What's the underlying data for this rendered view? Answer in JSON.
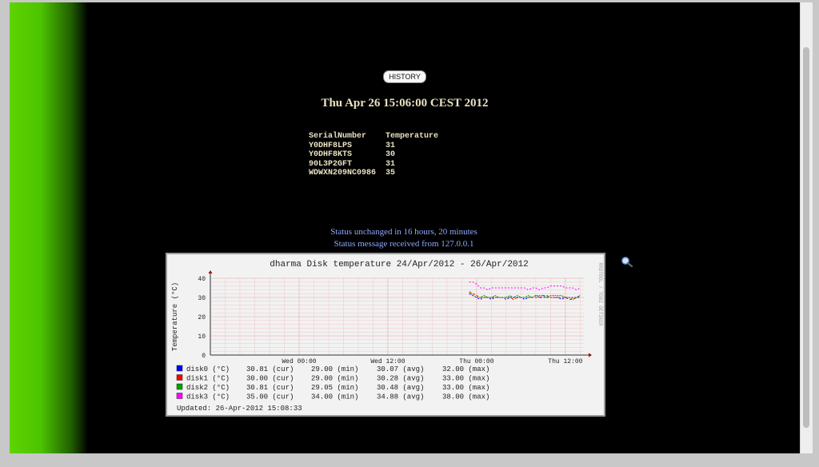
{
  "history_label": "HISTORY",
  "date": "Thu Apr 26 15:06:00 CEST 2012",
  "table": {
    "headers": [
      "SerialNumber",
      "Temperature"
    ],
    "rows": [
      [
        "Y0DHF8LPS",
        "31"
      ],
      [
        "Y0DHF8KTS",
        "30"
      ],
      [
        "90L3P2GFT",
        "31"
      ],
      [
        "WDWXN209NC0986",
        "35"
      ]
    ]
  },
  "status_line1": "Status unchanged in 16 hours, 20 minutes",
  "status_line2": "Status message received from 127.0.0.1",
  "zoom_icon": "magnifier-icon",
  "chart_data": {
    "type": "line",
    "title": "dharma Disk temperature 24/Apr/2012 - 26/Apr/2012",
    "ylabel": "Temperature (°C)",
    "watermark": "RRDTOOL / TOBI OETIKER",
    "ylim": [
      0,
      40
    ],
    "yticks": [
      0,
      10,
      20,
      30,
      40
    ],
    "xticks": [
      "Wed 00:00",
      "Wed 12:00",
      "Thu 00:00",
      "Thu 12:00"
    ],
    "grid": true,
    "series": [
      {
        "name": "disk0 (°C)",
        "color": "#0000ff",
        "cur": "30.81 (cur)",
        "min": "29.00 (min)",
        "avg": "30.07 (avg)",
        "max": "32.00 (max)",
        "x": [
          0,
          0.5,
          1,
          1.5,
          2,
          2.5,
          3,
          3.5,
          4,
          4.5,
          5,
          5.5,
          6,
          6.5,
          7,
          7.5,
          8,
          8.5,
          9,
          9.5,
          10,
          10.5,
          11,
          11.5,
          12,
          12.5,
          13,
          13.5,
          14,
          14.5,
          15
        ],
        "values": [
          32,
          31,
          30,
          29,
          30,
          30,
          29,
          30,
          30,
          30,
          29,
          30,
          30,
          30,
          30,
          29,
          30,
          30,
          31,
          30,
          30,
          30,
          30,
          30,
          30,
          29,
          30,
          30,
          30,
          30,
          31
        ]
      },
      {
        "name": "disk1 (°C)",
        "color": "#ff0000",
        "cur": "30.00 (cur)",
        "min": "29.00 (min)",
        "avg": "30.28 (avg)",
        "max": "33.00 (max)",
        "x": [
          0,
          0.5,
          1,
          1.5,
          2,
          2.5,
          3,
          3.5,
          4,
          4.5,
          5,
          5.5,
          6,
          6.5,
          7,
          7.5,
          8,
          8.5,
          9,
          9.5,
          10,
          10.5,
          11,
          11.5,
          12,
          12.5,
          13,
          13.5,
          14,
          14.5,
          15
        ],
        "values": [
          33,
          32,
          31,
          30,
          30,
          30,
          30,
          30,
          30,
          30,
          30,
          30,
          29,
          30,
          30,
          30,
          30,
          30,
          30,
          30,
          31,
          31,
          30,
          30,
          30,
          30,
          30,
          29,
          29,
          30,
          30
        ]
      },
      {
        "name": "disk2 (°C)",
        "color": "#00a000",
        "cur": "30.81 (cur)",
        "min": "29.05 (min)",
        "avg": "30.48 (avg)",
        "max": "33.00 (max)",
        "x": [
          0,
          0.5,
          1,
          1.5,
          2,
          2.5,
          3,
          3.5,
          4,
          4.5,
          5,
          5.5,
          6,
          6.5,
          7,
          7.5,
          8,
          8.5,
          9,
          9.5,
          10,
          10.5,
          11,
          11.5,
          12,
          12.5,
          13,
          13.5,
          14,
          14.5,
          15
        ],
        "values": [
          33,
          31,
          30,
          30,
          31,
          30,
          30,
          31,
          30,
          30,
          30,
          31,
          30,
          31,
          30,
          30,
          31,
          30,
          31,
          31,
          31,
          30,
          31,
          31,
          31,
          31,
          30,
          30,
          29,
          30,
          31
        ]
      },
      {
        "name": "disk3 (°C)",
        "color": "#ff00ff",
        "cur": "35.00 (cur)",
        "min": "34.00 (min)",
        "avg": "34.88 (avg)",
        "max": "38.00 (max)",
        "x": [
          0,
          0.5,
          1,
          1.5,
          2,
          2.5,
          3,
          3.5,
          4,
          4.5,
          5,
          5.5,
          6,
          6.5,
          7,
          7.5,
          8,
          8.5,
          9,
          9.5,
          10,
          10.5,
          11,
          11.5,
          12,
          12.5,
          13,
          13.5,
          14,
          14.5,
          15
        ],
        "values": [
          38,
          38,
          37,
          35,
          35,
          34,
          35,
          35,
          35,
          35,
          35,
          35,
          35,
          35,
          35,
          35,
          34,
          35,
          35,
          34,
          35,
          35,
          36,
          36,
          36,
          36,
          35,
          35,
          35,
          34,
          35
        ]
      }
    ],
    "updated": "Updated: 26-Apr-2012 15:08:33"
  }
}
